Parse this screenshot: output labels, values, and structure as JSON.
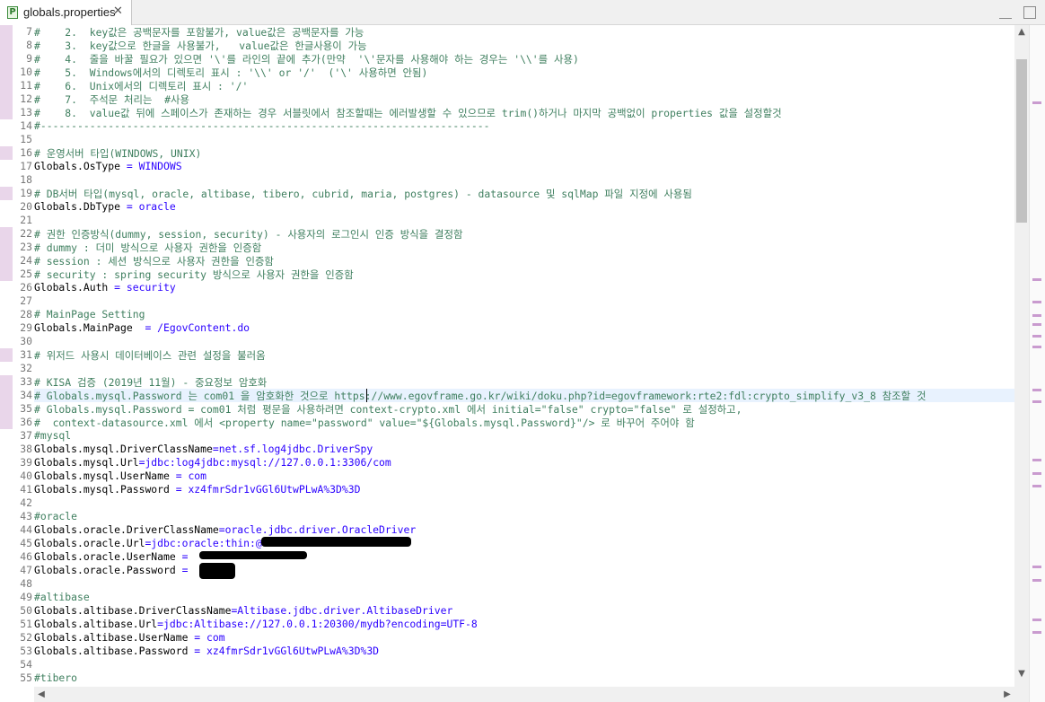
{
  "tab": {
    "title": "globals.properties",
    "close_glyph": "✕",
    "icon": "properties-file-icon"
  },
  "window": {
    "minimize": "minimize-icon",
    "maximize": "maximize-icon"
  },
  "editor": {
    "current_line": 34,
    "lines": [
      {
        "n": "7",
        "t": "#    2.  key값은 공백문자를 포함불가, value값은 공백문자를 가능",
        "type": "c",
        "mark": true
      },
      {
        "n": "8",
        "t": "#    3.  key값으로 한글을 사용불가,   value값은 한글사용이 가능",
        "type": "c",
        "mark": true
      },
      {
        "n": "9",
        "t": "#    4.  줄을 바꿀 필요가 있으면 '\\'를 라인의 끝에 추가(만약  '\\'문자를 사용해야 하는 경우는 '\\\\'를 사용)",
        "type": "c",
        "mark": true
      },
      {
        "n": "10",
        "t": "#    5.  Windows에서의 디렉토리 표시 : '\\\\' or '/'  ('\\' 사용하면 안됨)",
        "type": "c",
        "mark": true
      },
      {
        "n": "11",
        "t": "#    6.  Unix에서의 디렉토리 표시 : '/'",
        "type": "c",
        "mark": true
      },
      {
        "n": "12",
        "t": "#    7.  주석문 처리는  #사용",
        "type": "c",
        "mark": true
      },
      {
        "n": "13",
        "t": "#    8.  value값 뒤에 스페이스가 존재하는 경우 서블릿에서 참조할때는 에러발생할 수 있으므로 trim()하거나 마지막 공백없이 properties 값을 설정할것",
        "type": "c",
        "mark": true
      },
      {
        "n": "14",
        "t": "#-------------------------------------------------------------------------",
        "type": "c",
        "mark": false
      },
      {
        "n": "15",
        "t": "",
        "type": "k",
        "mark": false
      },
      {
        "n": "16",
        "t": "# 운영서버 타입(WINDOWS, UNIX)",
        "type": "c",
        "mark": true
      },
      {
        "n": "17",
        "t": "Globals.OsType = WINDOWS",
        "type": "kv",
        "key": "Globals.OsType",
        "val": " = WINDOWS",
        "mark": false
      },
      {
        "n": "18",
        "t": "",
        "type": "k",
        "mark": false
      },
      {
        "n": "19",
        "t": "# DB서버 타입(mysql, oracle, altibase, tibero, cubrid, maria, postgres) - datasource 및 sqlMap 파일 지정에 사용됨",
        "type": "c",
        "mark": true
      },
      {
        "n": "20",
        "t": "Globals.DbType = oracle",
        "type": "kv",
        "key": "Globals.DbType",
        "val": " = oracle",
        "mark": false
      },
      {
        "n": "21",
        "t": "",
        "type": "k",
        "mark": false
      },
      {
        "n": "22",
        "t": "# 권한 인증방식(dummy, session, security) - 사용자의 로그인시 인증 방식을 결정함",
        "type": "c",
        "mark": true
      },
      {
        "n": "23",
        "t": "# dummy : 더미 방식으로 사용자 권한을 인증함",
        "type": "c",
        "mark": true
      },
      {
        "n": "24",
        "t": "# session : 세션 방식으로 사용자 권한을 인증함",
        "type": "c",
        "mark": true
      },
      {
        "n": "25",
        "t": "# security : spring security 방식으로 사용자 권한을 인증함",
        "type": "c",
        "mark": true
      },
      {
        "n": "26",
        "t": "Globals.Auth = security",
        "type": "kv",
        "key": "Globals.Auth",
        "val": " = security",
        "mark": false
      },
      {
        "n": "27",
        "t": "",
        "type": "k",
        "mark": false
      },
      {
        "n": "28",
        "t": "# MainPage Setting",
        "type": "c",
        "mark": false
      },
      {
        "n": "29",
        "t": "Globals.MainPage  = /EgovContent.do",
        "type": "kv",
        "key": "Globals.MainPage",
        "val": "  = /EgovContent.do",
        "mark": false
      },
      {
        "n": "30",
        "t": "",
        "type": "k",
        "mark": false
      },
      {
        "n": "31",
        "t": "# 위저드 사용시 데이터베이스 관련 설정을 불러옴",
        "type": "c",
        "mark": true
      },
      {
        "n": "32",
        "t": "",
        "type": "k",
        "mark": false
      },
      {
        "n": "33",
        "t": "# KISA 검증 (2019년 11월) - 중요정보 암호화",
        "type": "c",
        "mark": true
      },
      {
        "n": "34",
        "t": "# Globals.mysql.Password 는 com01 을 암호화한 것으로 https://www.egovframe.go.kr/wiki/doku.php?id=egovframework:rte2:fdl:crypto_simplify_v3_8 참조할 것",
        "type": "c",
        "mark": true
      },
      {
        "n": "35",
        "t": "# Globals.mysql.Password = com01 처럼 평문을 사용하려면 context-crypto.xml 에서 initial=\"false\" crypto=\"false\" 로 설정하고,",
        "type": "c",
        "mark": true
      },
      {
        "n": "36",
        "t": "#  context-datasource.xml 에서 <property name=\"password\" value=\"${Globals.mysql.Password}\"/> 로 바꾸어 주어야 함",
        "type": "c",
        "mark": true
      },
      {
        "n": "37",
        "t": "#mysql",
        "type": "c",
        "mark": false
      },
      {
        "n": "38",
        "t": "Globals.mysql.DriverClassName=net.sf.log4jdbc.DriverSpy",
        "type": "kv",
        "key": "Globals.mysql.DriverClassName",
        "val": "=net.sf.log4jdbc.DriverSpy",
        "mark": false
      },
      {
        "n": "39",
        "t": "Globals.mysql.Url=jdbc:log4jdbc:mysql://127.0.0.1:3306/com",
        "type": "kv",
        "key": "Globals.mysql.Url",
        "val": "=jdbc:log4jdbc:mysql://127.0.0.1:3306/com",
        "mark": false
      },
      {
        "n": "40",
        "t": "Globals.mysql.UserName = com",
        "type": "kv",
        "key": "Globals.mysql.UserName",
        "val": " = com",
        "mark": false
      },
      {
        "n": "41",
        "t": "Globals.mysql.Password = xz4fmrSdr1vGGl6UtwPLwA%3D%3D",
        "type": "kv",
        "key": "Globals.mysql.Password",
        "val": " = xz4fmrSdr1vGGl6UtwPLwA%3D%3D",
        "mark": false
      },
      {
        "n": "42",
        "t": "",
        "type": "k",
        "mark": false
      },
      {
        "n": "43",
        "t": "#oracle",
        "type": "c",
        "mark": false
      },
      {
        "n": "44",
        "t": "Globals.oracle.DriverClassName=oracle.jdbc.driver.OracleDriver",
        "type": "kv",
        "key": "Globals.oracle.DriverClassName",
        "val": "=oracle.jdbc.driver.OracleDriver",
        "mark": false
      },
      {
        "n": "45",
        "t": "Globals.oracle.Url=jdbc:oracle:thin:@",
        "type": "kv",
        "key": "Globals.oracle.Url",
        "val": "=jdbc:oracle:thin:@",
        "mark": false
      },
      {
        "n": "46",
        "t": "Globals.oracle.UserName = ",
        "type": "kv",
        "key": "Globals.oracle.UserName",
        "val": " = ",
        "mark": false
      },
      {
        "n": "47",
        "t": "Globals.oracle.Password = ",
        "type": "kv",
        "key": "Globals.oracle.Password",
        "val": " = ",
        "mark": false
      },
      {
        "n": "48",
        "t": "",
        "type": "k",
        "mark": false
      },
      {
        "n": "49",
        "t": "#altibase",
        "type": "c",
        "mark": false
      },
      {
        "n": "50",
        "t": "Globals.altibase.DriverClassName=Altibase.jdbc.driver.AltibaseDriver",
        "type": "kv",
        "key": "Globals.altibase.DriverClassName",
        "val": "=Altibase.jdbc.driver.AltibaseDriver",
        "mark": false
      },
      {
        "n": "51",
        "t": "Globals.altibase.Url=jdbc:Altibase://127.0.0.1:20300/mydb?encoding=UTF-8",
        "type": "kv",
        "key": "Globals.altibase.Url",
        "val": "=jdbc:Altibase://127.0.0.1:20300/mydb?encoding=UTF-8",
        "mark": false
      },
      {
        "n": "52",
        "t": "Globals.altibase.UserName = com",
        "type": "kv",
        "key": "Globals.altibase.UserName",
        "val": " = com",
        "mark": false
      },
      {
        "n": "53",
        "t": "Globals.altibase.Password = xz4fmrSdr1vGGl6UtwPLwA%3D%3D",
        "type": "kv",
        "key": "Globals.altibase.Password",
        "val": " = xz4fmrSdr1vGGl6UtwPLwA%3D%3D",
        "mark": false
      },
      {
        "n": "54",
        "t": "",
        "type": "k",
        "mark": false
      },
      {
        "n": "55",
        "t": "#tibero",
        "type": "c",
        "mark": false
      }
    ]
  },
  "scrollbar": {
    "up": "▲",
    "down": "▼",
    "left": "◀",
    "right": "▶"
  },
  "colors": {
    "comment": "#3f7f5f",
    "key": "#000000",
    "value": "#2a00ff",
    "current_line": "#e8f2fe",
    "marker": "#e9d6ea"
  }
}
